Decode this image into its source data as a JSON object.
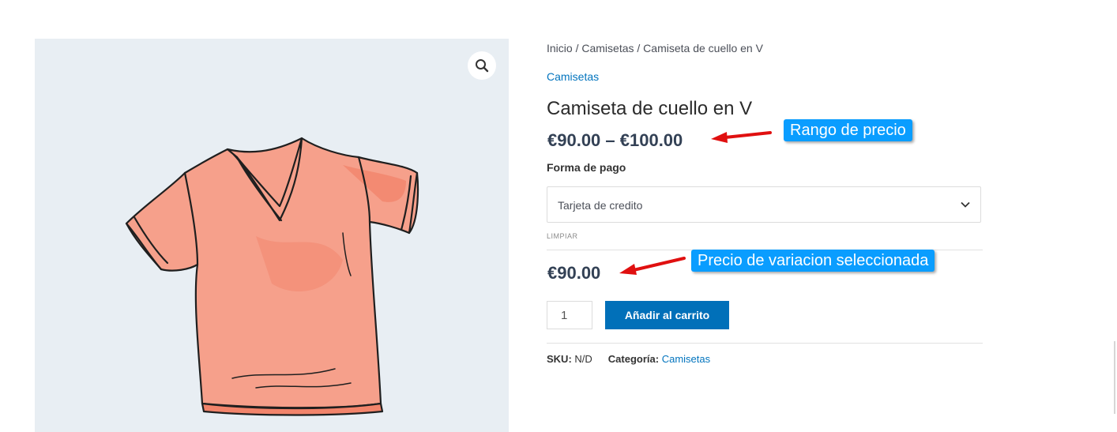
{
  "breadcrumb": {
    "home": "Inicio",
    "sep1": " / ",
    "category": "Camisetas",
    "sep2": " / ",
    "current": "Camiseta de cuello en V"
  },
  "product": {
    "category_link": "Camisetas",
    "title": "Camiseta de cuello en V",
    "price_range": "€90.00 – €100.00",
    "variation_label": "Forma de pago",
    "selected_option": "Tarjeta de credito",
    "reset_label": "LIMPIAR",
    "variation_price": "€90.00",
    "quantity": "1",
    "add_to_cart_label": "Añadir al carrito",
    "sku_label": "SKU:",
    "sku_value": "N/D",
    "category_label": "Categoría:",
    "category_value": "Camisetas"
  },
  "annotations": {
    "range_callout": "Rango de precio",
    "variation_callout": "Precio de variacion seleccionada"
  },
  "icons": {
    "zoom": "search-icon",
    "select": "chevron-down-icon"
  },
  "colors": {
    "link": "#0274be",
    "button": "#0170b9",
    "callout": "#0a9dff",
    "arrow": "#e01010",
    "shirt": "#f2a28d"
  }
}
